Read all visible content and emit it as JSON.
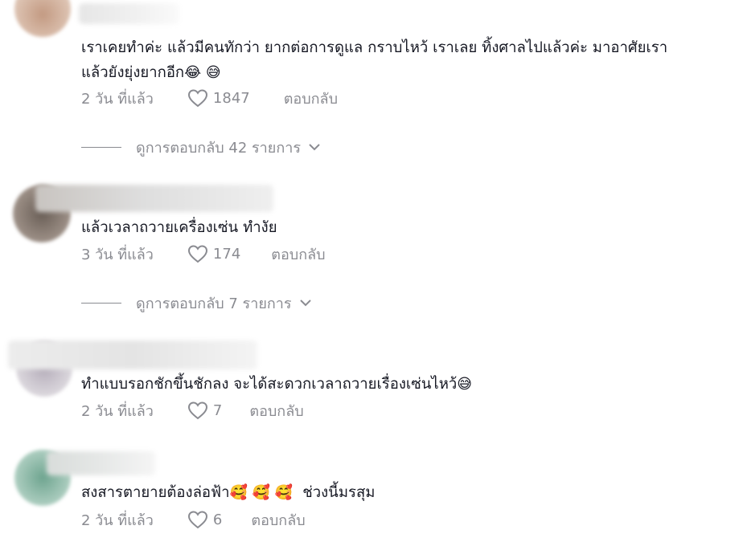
{
  "comments": [
    {
      "text_line1": "เราเคยทำค่ะ แล้วมีคนทักว่า ยากต่อการดูแล กราบไหว้ เราเลย ทิ้งศาลไปแล้วค่ะ มาอาศัยเรา",
      "text_line2": "แล้วยังยุ่งยากอีก",
      "emojis": "😂 😅",
      "time": "2 วัน ที่แล้ว",
      "likes": "1847",
      "reply_label": "ตอบกลับ",
      "replies_label": "ดูการตอบกลับ 42 รายการ",
      "avatar_color": "#d2b29c"
    },
    {
      "text_line1": "แล้วเวลาถวายเครื่องเซ่น ทำงัย",
      "time": "3 วัน ที่แล้ว",
      "likes": "174",
      "reply_label": "ตอบกลับ",
      "replies_label": "ดูการตอบกลับ 7 รายการ",
      "avatar_color": "#7b7068"
    },
    {
      "text_line1": "ทำแบบรอกชักขึ้นชักลง จะได้สะดวกเวลาถวายเรื่องเซ่นไหว้",
      "emojis": "😅",
      "time": "2 วัน ที่แล้ว",
      "likes": "7",
      "reply_label": "ตอบกลับ",
      "avatar_color": "#c9c4cc"
    },
    {
      "text_line1": "สงสารตายายต้องล่อฟ้า",
      "emojis": "🥰 🥰 🥰",
      "text_line1_suffix": "ช่วงนี้มรสุม",
      "time": "2 วัน ที่แล้ว",
      "likes": "6",
      "reply_label": "ตอบกลับ",
      "avatar_color": "#8fb8a8"
    }
  ]
}
